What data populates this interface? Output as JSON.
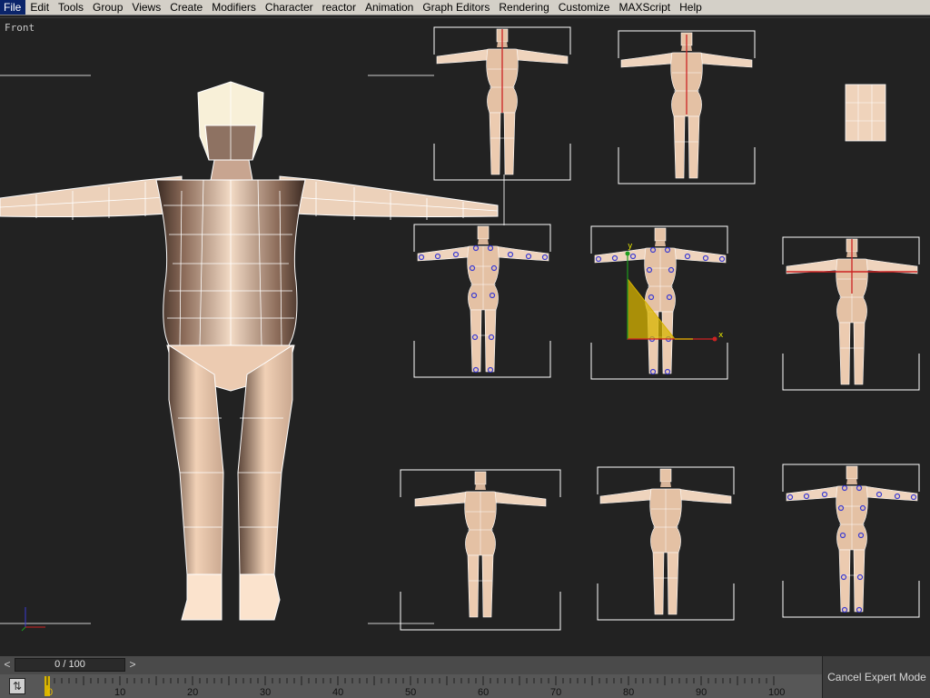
{
  "menu": [
    "File",
    "Edit",
    "Tools",
    "Group",
    "Views",
    "Create",
    "Modifiers",
    "Character",
    "reactor",
    "Animation",
    "Graph Editors",
    "Rendering",
    "Customize",
    "MAXScript",
    "Help"
  ],
  "viewport": {
    "label": "Front",
    "axis_x": "x",
    "axis_y": "y"
  },
  "colors": {
    "skin": "#e9c9ad",
    "wire": "#ffffff",
    "vertex": "#3b3bd1",
    "bg": "#222222",
    "highlight": "#cc2222",
    "gizmo_fill": "#d8b400"
  },
  "timeline": {
    "current_frame": "0 / 100",
    "prev_label": "<",
    "next_label": ">",
    "progress": 0.0
  },
  "ruler": {
    "ticks": [
      "0",
      "10",
      "20",
      "30",
      "40",
      "50",
      "60",
      "70",
      "80",
      "90",
      "100"
    ]
  },
  "expert_button": "Cancel Expert Mode",
  "icons": {
    "key": "key-mode-icon",
    "axis": "axis-tripod-icon",
    "gizmo": "transform-gizmo-icon"
  }
}
